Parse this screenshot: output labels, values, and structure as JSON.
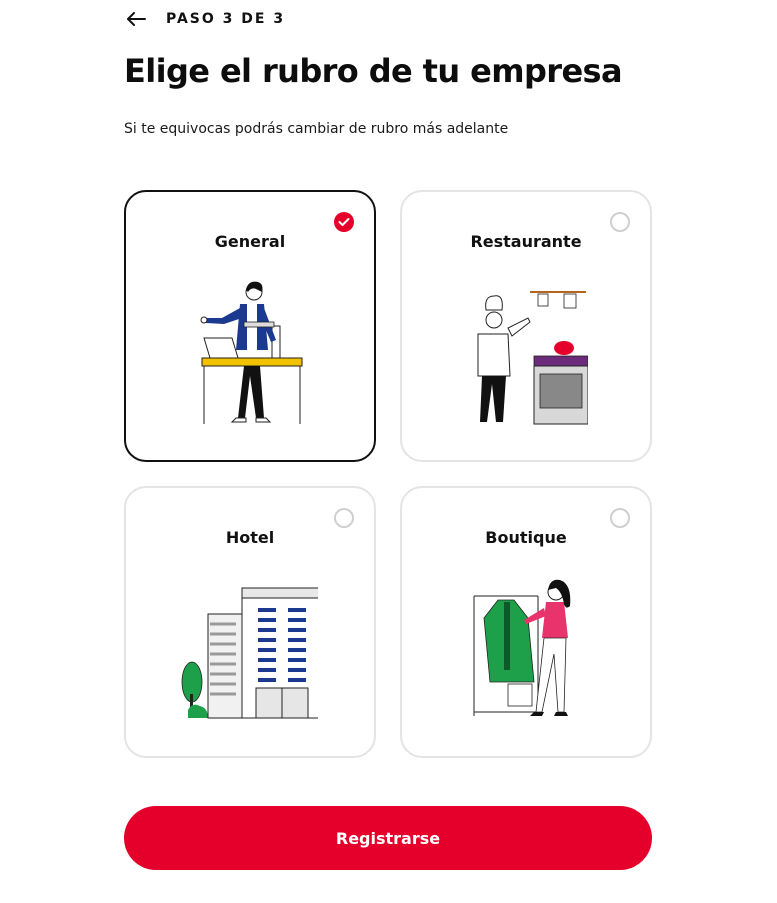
{
  "header": {
    "back_icon": "arrow-left-icon",
    "step": "PASO 3 DE 3"
  },
  "title": "Elige el rubro de tu empresa",
  "subtitle": "Si te equivocas podrás cambiar de rubro más adelante",
  "options": [
    {
      "label": "General",
      "selected": true,
      "illustration": "businessman-at-desk-illustration"
    },
    {
      "label": "Restaurante",
      "selected": false,
      "illustration": "chef-at-stove-illustration"
    },
    {
      "label": "Hotel",
      "selected": false,
      "illustration": "hotel-building-illustration"
    },
    {
      "label": "Boutique",
      "selected": false,
      "illustration": "woman-at-clothes-rack-illustration"
    }
  ],
  "cta": {
    "label": "Registrarse"
  },
  "colors": {
    "accent": "#e4002b",
    "selected_border": "#111111",
    "card_border": "#e4e4e4"
  }
}
